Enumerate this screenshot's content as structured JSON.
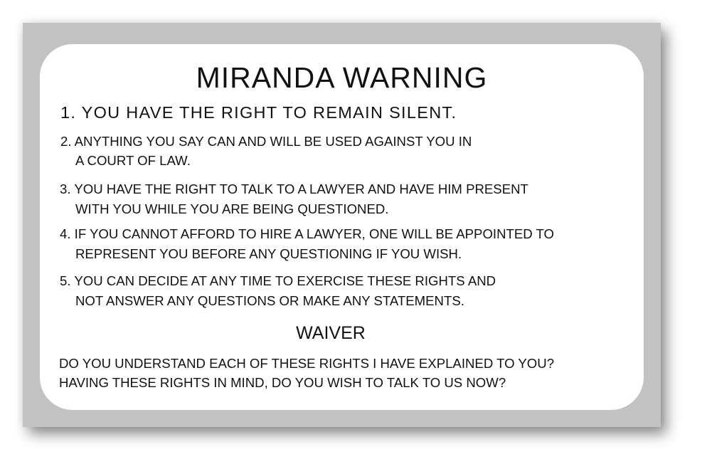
{
  "title": "MIRANDA WARNING",
  "rights": [
    {
      "lines": [
        "1. YOU HAVE THE RIGHT TO REMAIN SILENT."
      ]
    },
    {
      "lines": [
        "2. ANYTHING YOU SAY CAN AND WILL BE USED AGAINST YOU IN",
        "A COURT OF LAW."
      ]
    },
    {
      "lines": [
        "3. YOU HAVE THE RIGHT TO TALK TO A LAWYER AND HAVE HIM PRESENT",
        "WITH YOU WHILE YOU ARE BEING QUESTIONED."
      ]
    },
    {
      "lines": [
        "4. IF YOU CANNOT AFFORD TO HIRE A LAWYER, ONE WILL BE APPOINTED TO",
        "REPRESENT YOU BEFORE ANY QUESTIONING IF YOU WISH."
      ]
    },
    {
      "lines": [
        "5. YOU CAN DECIDE AT ANY TIME TO EXERCISE THESE RIGHTS AND",
        "NOT ANSWER ANY QUESTIONS OR MAKE ANY STATEMENTS."
      ]
    }
  ],
  "waiver": {
    "heading": "WAIVER",
    "lines": [
      "DO YOU UNDERSTAND EACH OF THESE RIGHTS I HAVE EXPLAINED TO YOU?",
      "HAVING THESE RIGHTS IN MIND, DO YOU WISH TO TALK TO US NOW?"
    ]
  }
}
